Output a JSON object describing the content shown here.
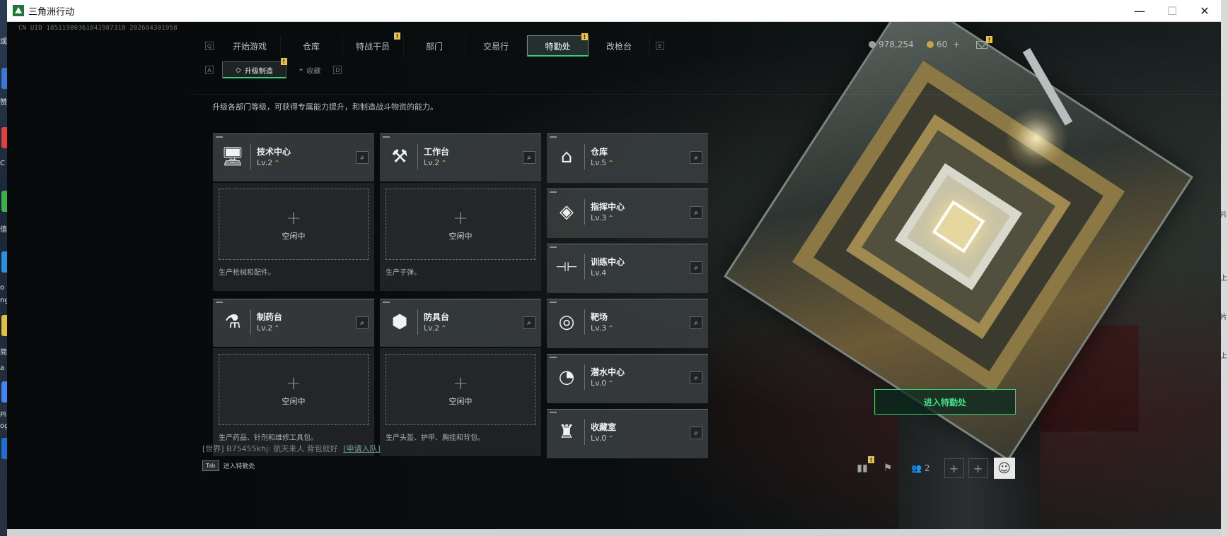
{
  "window": {
    "title": "三角洲行动",
    "controls": [
      "—",
      "☐",
      "✕"
    ]
  },
  "desktop": {
    "left_labels": [
      "或",
      "赞",
      "C",
      "值",
      "o",
      "ng",
      "简",
      "a",
      "Pi",
      "og"
    ],
    "right_labels": [
      "片",
      "上",
      "片",
      "上"
    ]
  },
  "uid": "CN UID 18511980361841987318 202604301958",
  "nav": {
    "left_key": "Q",
    "right_key": "E",
    "tabs": [
      {
        "label": "开始游戏",
        "badge": ""
      },
      {
        "label": "仓库",
        "badge": ""
      },
      {
        "label": "特战干员",
        "badge": "!"
      },
      {
        "label": "部门",
        "badge": ""
      },
      {
        "label": "交易行",
        "badge": ""
      },
      {
        "label": "特勤处",
        "badge": "!",
        "active": true
      },
      {
        "label": "改枪台",
        "badge": ""
      }
    ]
  },
  "currency": {
    "coins": "978,254",
    "tickets": "60",
    "plus": "+"
  },
  "subtabs": {
    "left_key": "A",
    "right_key": "D",
    "items": [
      {
        "label": "升级制造",
        "icon": "◇",
        "badge": "!",
        "active": true
      },
      {
        "label": "收藏",
        "icon": "⌖",
        "badge": ""
      }
    ]
  },
  "description": "升级各部门等级，可获得专属能力提升，和制造战斗物资的能力。",
  "production": [
    {
      "name": "技术中心",
      "level": "Lv.2",
      "icon": "monitor-icon",
      "glyph": "🖥",
      "slot": "空闲中",
      "desc": "生产枪械和配件。"
    },
    {
      "name": "工作台",
      "level": "Lv.2",
      "icon": "tools-icon",
      "glyph": "⚒",
      "slot": "空闲中",
      "desc": "生产子弹。"
    },
    {
      "name": "制药台",
      "level": "Lv.2",
      "icon": "microscope-icon",
      "glyph": "⚗",
      "slot": "空闲中",
      "desc": "生产药品、针剂和维修工具包。"
    },
    {
      "name": "防具台",
      "level": "Lv.2",
      "icon": "cubes-icon",
      "glyph": "⬢",
      "slot": "空闲中",
      "desc": "生产头盔、护甲、胸挂和背包。"
    }
  ],
  "facilities": [
    {
      "name": "仓库",
      "level": "Lv.5",
      "icon": "warehouse-icon",
      "glyph": "⌂",
      "upgrade": true
    },
    {
      "name": "指挥中心",
      "level": "Lv.3",
      "icon": "command-icon",
      "glyph": "◈",
      "upgrade": true
    },
    {
      "name": "训练中心",
      "level": "Lv.4",
      "icon": "dumbbell-icon",
      "glyph": "⊣⊢",
      "upgrade": false
    },
    {
      "name": "靶场",
      "level": "Lv.3",
      "icon": "target-icon",
      "glyph": "◎",
      "upgrade": true
    },
    {
      "name": "潜水中心",
      "level": "Lv.0",
      "icon": "diving-mask-icon",
      "glyph": "◔",
      "upgrade": true
    },
    {
      "name": "收藏室",
      "level": "Lv.0",
      "icon": "collection-icon",
      "glyph": "♜",
      "upgrade": true
    }
  ],
  "upgrade_glyph": "⌃",
  "search_glyph": "⌕",
  "plus_glyph": "+",
  "enter_button": "进入特勤处",
  "chat": {
    "channel": "[世界]",
    "message": "B75455khj: 航天来人 背包就好",
    "link": "[申请入队]"
  },
  "tab_hint": {
    "key": "Tab",
    "label": "进入特勤处"
  },
  "bottom": {
    "friends_count": "2",
    "add": "+"
  },
  "colors": {
    "accent": "#35d27a",
    "badge": "#e9c24a",
    "card_bg": "#373c3e"
  }
}
